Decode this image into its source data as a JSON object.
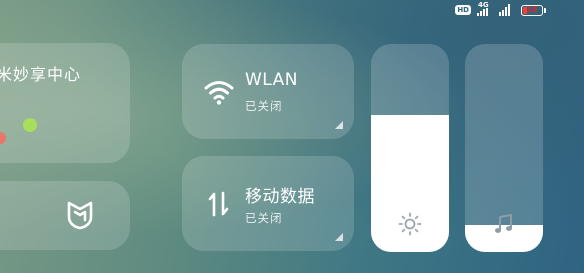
{
  "status_bar": {
    "hd_label": "HD",
    "network_type": "4G",
    "battery_level": "18",
    "battery_color": "#ff3b30"
  },
  "mijia_card": {
    "title": "米妙享中心",
    "icon": "mijia-logo-icon"
  },
  "tiles": {
    "wlan": {
      "icon": "wifi-icon",
      "title": "WLAN",
      "status": "已关闭"
    },
    "mobile_data": {
      "icon": "data-transfer-icon",
      "title": "移动数据",
      "status": "已关闭"
    }
  },
  "sliders": {
    "brightness": {
      "icon": "sun-icon",
      "level": 0.66
    },
    "volume": {
      "icon": "music-note-icon",
      "level": 0.13
    }
  }
}
